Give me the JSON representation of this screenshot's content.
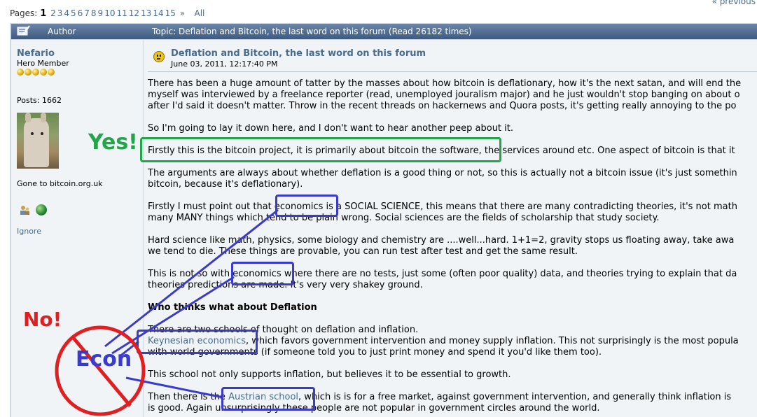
{
  "pager": {
    "label": "Pages:",
    "current": "1",
    "pages": [
      "2",
      "3",
      "4",
      "5",
      "6",
      "7",
      "8",
      "9",
      "10",
      "11",
      "12",
      "13",
      "14",
      "15"
    ],
    "next": "»",
    "all": "All",
    "previous": "« previous"
  },
  "header": {
    "author": "Author",
    "topic": "Topic: Deflation and Bitcoin, the last word on this forum  (Read 26182 times)"
  },
  "user": {
    "name": "Nefario",
    "rank": "Hero Member",
    "posts": "Posts: 1662",
    "personal_text": "Gone to bitcoin.org.uk",
    "ignore": "Ignore",
    "star_count": 5
  },
  "post": {
    "title": "Deflation and Bitcoin, the last word on this forum",
    "date": "June 03, 2011, 12:17:40 PM",
    "p1": [
      "There has been a huge amount of tatter by the masses about how bitcoin is deflationary, how it's the next satan, and will end the",
      "myself was interviewed by a freelance reporter (read, unemployed jouralism major) and he just wouldn't stop banging on about o",
      "after I'd said it doesn't matter. Throw in the recent threads on hackernews and Quora posts, it's getting really annoying to the po"
    ],
    "p2": [
      "So I'm going to lay it down here, and I don't want to hear another peep about it."
    ],
    "p3": [
      "Firstly this is the bitcoin project, it is primarily about bitcoin the software, the services around etc. One aspect of bitcoin is that it"
    ],
    "p4": [
      "The arguments are always about whether deflation is a good thing or not, so this is actually not a bitcoin issue (it's just somethin",
      "bitcoin, because it's deflationary)."
    ],
    "p5": [
      "Firstly I must point out that economics is a SOCIAL SCIENCE, this means that there are many contradicting theories, it's not math",
      "many MANY things which tend to be plain wrong. Social sciences are the fields of scholarship that study society."
    ],
    "p6": [
      "Hard science like math, physics, some biology and chemistry are ....well...hard. 1+1=2, gravity stops us floating away, take awa",
      "we tend to die. These things are provable, you can run test after test and get the same result."
    ],
    "p7": [
      "This is not so with economics where there are no tests, just some (often poor quality) data, and theories trying to explain that da",
      "theories predictions are made. It's very very shakey ground."
    ],
    "heading": "Who thinks what about Deflation",
    "p8": [
      "There are two schools of thought on deflation and inflation."
    ],
    "p9a_link": "Keynesian economics",
    "p9a_rest": ", which favors government intervention and money supply inflation. This not surprisingly is the most popula",
    "p9b": "with world governments (if someone told you to just print money and spend it you'd like them too).",
    "p10": [
      "This school not only supports inflation, but believes it to be essential to growth."
    ],
    "p11a_pre": "Then there is the ",
    "p11a_link": "Austrian school",
    "p11a_rest": ", which is is for a free market, against government intervention, and generally think inflation is",
    "p11b": "is good. Again unsurprisingly these people are not popular in government circles around the world."
  },
  "annotations": {
    "yes": "Yes!",
    "no": "No!",
    "econ": "Econ"
  },
  "colors": {
    "accent_blue": "#476c8e",
    "annotation_green": "#22a64a",
    "annotation_red": "#e02020",
    "annotation_blue": "#3a3acc"
  }
}
